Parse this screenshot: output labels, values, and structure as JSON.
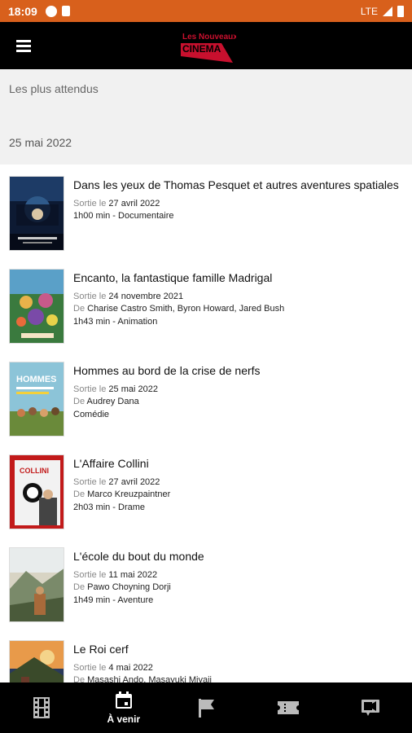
{
  "status_bar": {
    "time": "18:09",
    "network": "LTE"
  },
  "app_bar": {
    "logo_line1": "Les Nouveaux",
    "logo_line2": "CINEMA"
  },
  "section": {
    "title": "Les plus attendus",
    "date": "25 mai 2022"
  },
  "labels": {
    "release": "Sortie le",
    "by": "De"
  },
  "movies": [
    {
      "title": "Dans les yeux de Thomas Pesquet et autres aventures spatiales",
      "release": "27 avril 2022",
      "director": "",
      "info": "1h00 min - Documentaire"
    },
    {
      "title": "Encanto, la fantastique famille Madrigal",
      "release": "24 novembre 2021",
      "director": "Charise Castro Smith, Byron Howard, Jared Bush",
      "info": "1h43 min - Animation"
    },
    {
      "title": "Hommes au bord de la crise de nerfs",
      "release": "25 mai 2022",
      "director": "Audrey Dana",
      "info": "Comédie"
    },
    {
      "title": "L'Affaire Collini",
      "release": "27 avril 2022",
      "director": "Marco Kreuzpaintner",
      "info": "2h03 min - Drame"
    },
    {
      "title": "L'école du bout du monde",
      "release": "11 mai 2022",
      "director": "Pawo Choyning Dorji",
      "info": "1h49 min - Aventure"
    },
    {
      "title": "Le Roi cerf",
      "release": "4 mai 2022",
      "director": "Masashi Ando, Masayuki Miyaji",
      "info": ""
    }
  ],
  "poster_texts": {
    "hommes": "HOMMES",
    "collini": "COLLINI"
  },
  "bottom_nav": [
    {
      "icon": "film-icon",
      "label": ""
    },
    {
      "icon": "calendar-icon",
      "label": "À venir"
    },
    {
      "icon": "flag-icon",
      "label": ""
    },
    {
      "icon": "ticket-icon",
      "label": ""
    },
    {
      "icon": "video-icon",
      "label": ""
    }
  ],
  "colors": {
    "status_bar": "#d8601c",
    "app_bar": "#000000",
    "logo_red": "#c8102e",
    "section_bg": "#f1f1f1"
  }
}
